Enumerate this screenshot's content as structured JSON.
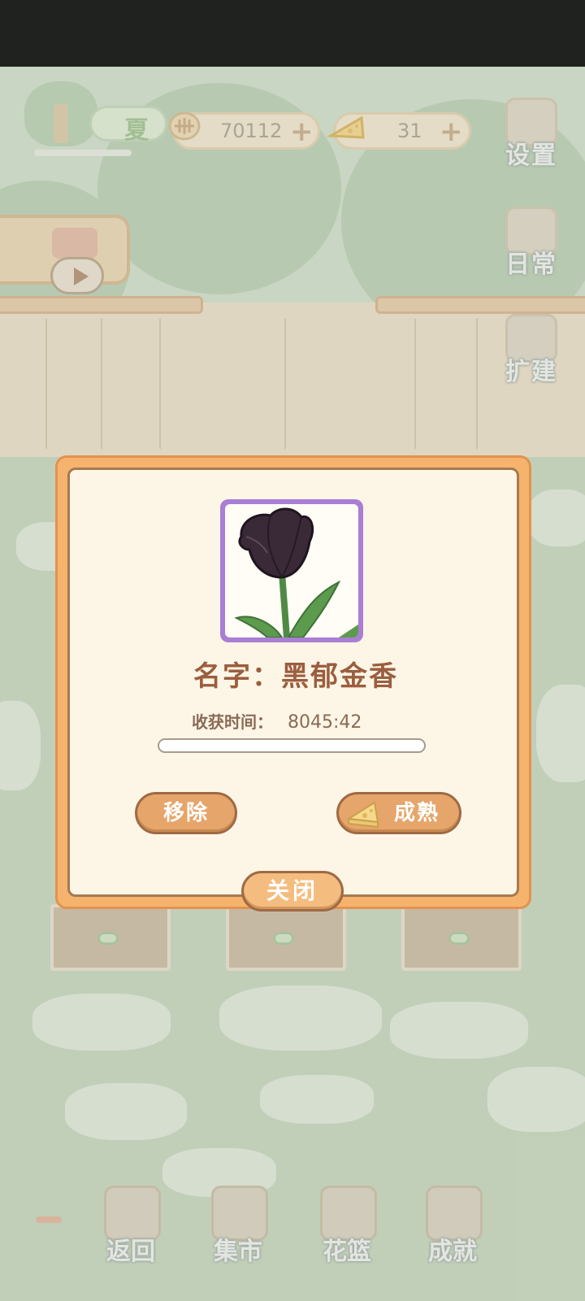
{
  "hud": {
    "season": "夏",
    "coins": "70112",
    "cheese": "31",
    "plus": "+"
  },
  "side_menu": {
    "settings": "设置",
    "daily": "日常",
    "expand": "扩建"
  },
  "dialog": {
    "name_label": "名字：黑郁金香",
    "harvest_label": "收获时间：",
    "harvest_time": "8045:42",
    "progress": 0.0,
    "remove": "移除",
    "ripen": "成熟",
    "close": "关闭"
  },
  "bottom_nav": {
    "back": "返回",
    "market": "集市",
    "basket": "花篮",
    "achievements": "成就"
  },
  "colors": {
    "dialog_border": "#f6b36d",
    "dialog_bg": "#fdf6e6",
    "frame_purple": "#a97ed4",
    "button": "#e6a56a",
    "name_text": "#9b5e3e"
  }
}
